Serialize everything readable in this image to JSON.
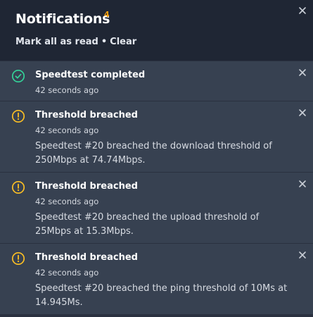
{
  "header": {
    "title": "Notifications",
    "badge_count": "4",
    "mark_all_read_label": "Mark all as read",
    "separator": "•",
    "clear_label": "Clear",
    "close_icon": "close-icon"
  },
  "colors": {
    "background": "#1e2533",
    "card": "#374151",
    "success": "#34d399",
    "warning": "#fbbf24",
    "badge": "#f59e0b"
  },
  "notifications": [
    {
      "icon": "check-circle-icon",
      "title": "Speedtest completed",
      "time": "42 seconds ago",
      "body": ""
    },
    {
      "icon": "warning-circle-icon",
      "title": "Threshold breached",
      "time": "42 seconds ago",
      "body": "Speedtest #20 breached the download threshold of 250Mbps at 74.74Mbps."
    },
    {
      "icon": "warning-circle-icon",
      "title": "Threshold breached",
      "time": "42 seconds ago",
      "body": "Speedtest #20 breached the upload threshold of 25Mbps at 15.3Mbps."
    },
    {
      "icon": "warning-circle-icon",
      "title": "Threshold breached",
      "time": "42 seconds ago",
      "body": "Speedtest #20 breached the ping threshold of 10Ms at 14.945Ms."
    }
  ]
}
